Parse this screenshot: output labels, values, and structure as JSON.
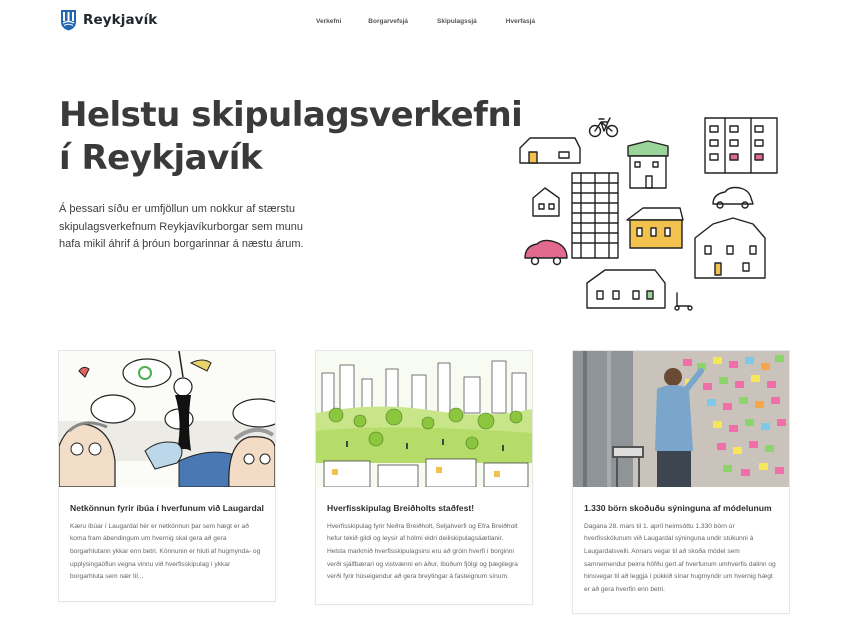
{
  "header": {
    "logo_text": "Reykjavík",
    "nav": [
      "Verkefni",
      "Borgarvefsjá",
      "Skipulagssjá",
      "Hverfasjá"
    ]
  },
  "hero": {
    "title_line1": "Helstu skipulagsverkefni",
    "title_line2": "í Reykjavík",
    "intro": "Á þessari síðu er umfjöllun um nokkur af stærstu skipulagsverkefnum Reykjavíkurborgar sem munu hafa mikil áhrif á þróun borgarinnar á næstu árum."
  },
  "cards": [
    {
      "title": "Netkönnun fyrir íbúa í hverfunum við Laugardal",
      "text": "Kæru íbúar í Laugardal hér er netkönnun þar sem hægt er að koma fram ábendingum um hvernig skal gera að gera borgarhlutann ykkar enn betri. Könnunin er hluti af hugmynda- og upplýsingaöflun vegna vinnu við hverfisskipulag í ykkar borgarhluta sem nær til..."
    },
    {
      "title": "Hverfisskipulag Breiðholts staðfest!",
      "text": "Hverfisskipulag fyrir Neðra Breiðholt, Seljahverfi og Efra Breiðholt hefur tekið gildi og leysir af hólmi eldri deiliskipulagsáætlanir. Helsta markmið hverfisskipulagsins eru að gróin hverfi í borginni verði sjálfbærari og vistvænni en áður, íbúðum fjölgi og þægilegra verði fyrir húseigendur að gera breytingar á fasteignum sínum."
    },
    {
      "title": "1.330 börn skoðuðu sýninguna af módelunum",
      "text": "Dagana 28. mars til 1. apríl heimsóttu 1.330 börn úr hverfisskólunum við Laugardal sýninguna undir stúkunni á Laugardalsvelli. Annars vegar til að skoða módel sem samnemendur þeirra höfðu gert af hverfunum umhverfis dalinn og hinsvegar til að leggja í púkkið sínar hugmyndir um hvernig hægt er að gera hverfin enn betri."
    }
  ],
  "colors": {
    "brand_blue": "#2166b0",
    "title": "#3a3a3a",
    "pink": "#e26a8f",
    "green": "#9bd49a",
    "yellow": "#f2c14e"
  }
}
